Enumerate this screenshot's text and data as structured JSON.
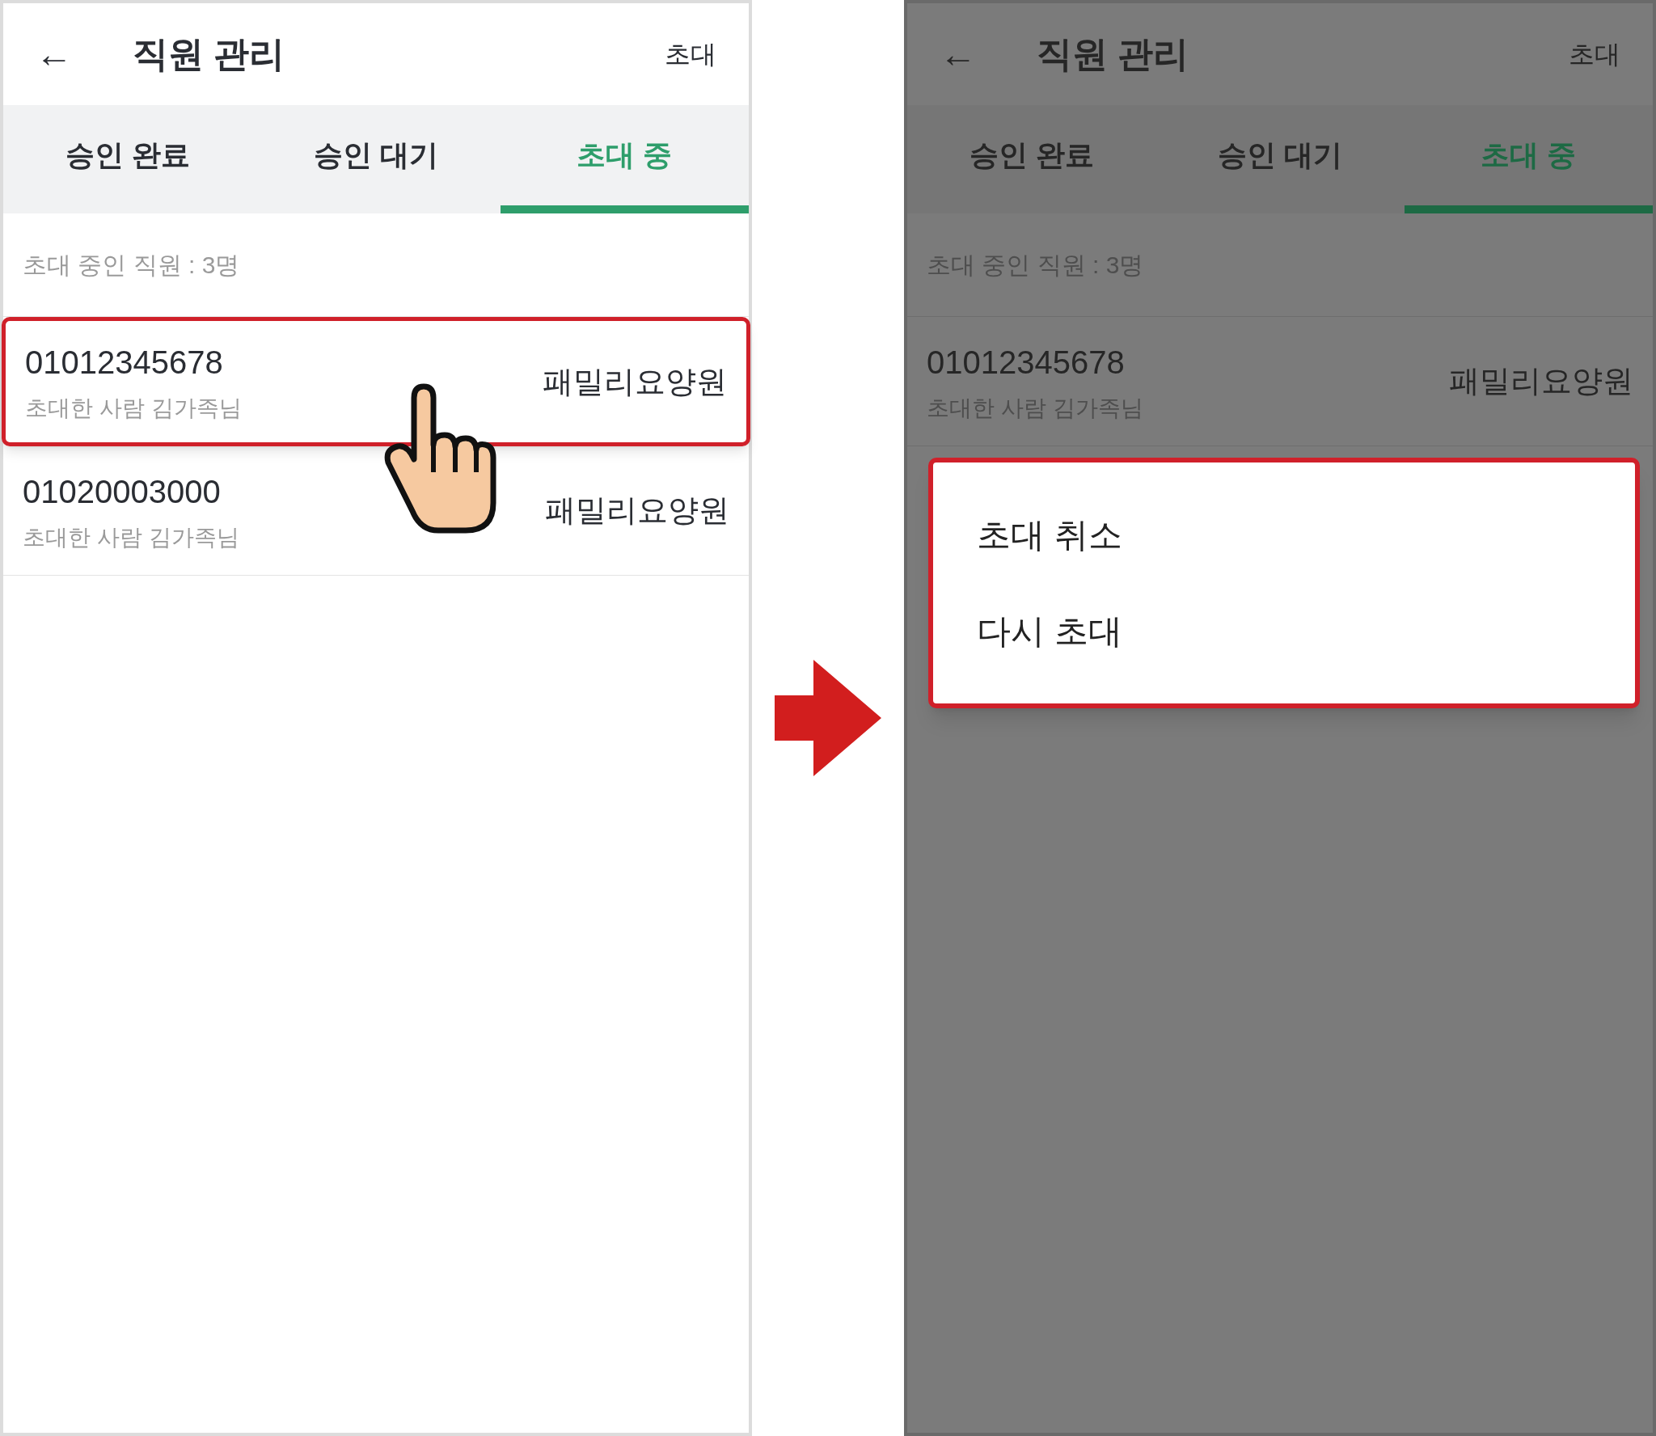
{
  "screens": [
    {
      "dimmed": false,
      "header": {
        "back": "←",
        "title": "직원 관리",
        "action": "초대"
      },
      "tabs": [
        {
          "label": "승인 완료",
          "selected": false
        },
        {
          "label": "승인 대기",
          "selected": false
        },
        {
          "label": "초대 중",
          "selected": true
        }
      ],
      "count_label": "초대 중인 직원 : 3명",
      "rows": [
        {
          "phone": "01012345678",
          "inviter": "초대한 사람 김가족님",
          "facility": "패밀리요양원",
          "highlighted": true
        },
        {
          "phone": "01020003000",
          "inviter": "초대한 사람 김가족님",
          "facility": "패밀리요양원",
          "highlighted": false
        }
      ],
      "tap_hint": true
    },
    {
      "dimmed": true,
      "header": {
        "back": "←",
        "title": "직원 관리",
        "action": "초대"
      },
      "tabs": [
        {
          "label": "승인 완료",
          "selected": false
        },
        {
          "label": "승인 대기",
          "selected": false
        },
        {
          "label": "초대 중",
          "selected": true
        }
      ],
      "count_label": "초대 중인 직원 : 3명",
      "rows": [
        {
          "phone": "01012345678",
          "inviter": "초대한 사람 김가족님",
          "facility": "패밀리요양원",
          "highlighted": false
        }
      ],
      "tap_hint": false,
      "menu": {
        "highlighted": true,
        "items": [
          "초대 취소",
          "다시 초대"
        ]
      }
    }
  ]
}
